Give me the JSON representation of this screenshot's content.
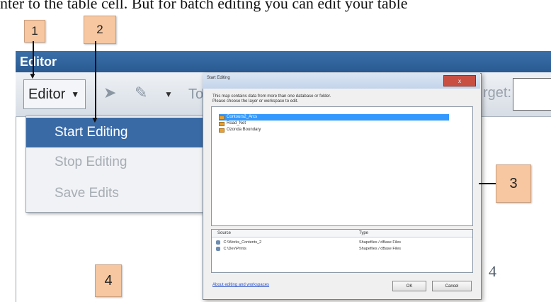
{
  "document": {
    "line_text": "nter to the table cell. But for batch editing you can edit your table"
  },
  "callouts": [
    "1",
    "2",
    "3",
    "4",
    "4"
  ],
  "editor": {
    "title": "Editor",
    "dropdown_label": "Editor",
    "toolbar_partial_text": "To",
    "target_label_partial": "rget:"
  },
  "menu": {
    "items": [
      {
        "label": "Start Editing"
      },
      {
        "label": "Stop Editing"
      },
      {
        "label": "Save Edits"
      }
    ]
  },
  "dialog": {
    "title": "Start Editing",
    "close_label": "x",
    "message_line1": "This map contains data from more than one database or folder.",
    "message_line2": "Please choose the layer or workspace to edit.",
    "layers": [
      "Contours2_Arcs",
      "Road_Net",
      "Ozonda Boundary"
    ],
    "source_header": "Source",
    "type_header": "Type",
    "sources": [
      {
        "path": "C:\\Works_Contents_2",
        "type": "Shapefiles / dBase Files"
      },
      {
        "path": "C:\\Dev\\Prints",
        "type": "Shapefiles / dBase Files"
      }
    ],
    "help_link": "About editing and workspaces",
    "ok_label": "OK",
    "cancel_label": "Cancel"
  }
}
